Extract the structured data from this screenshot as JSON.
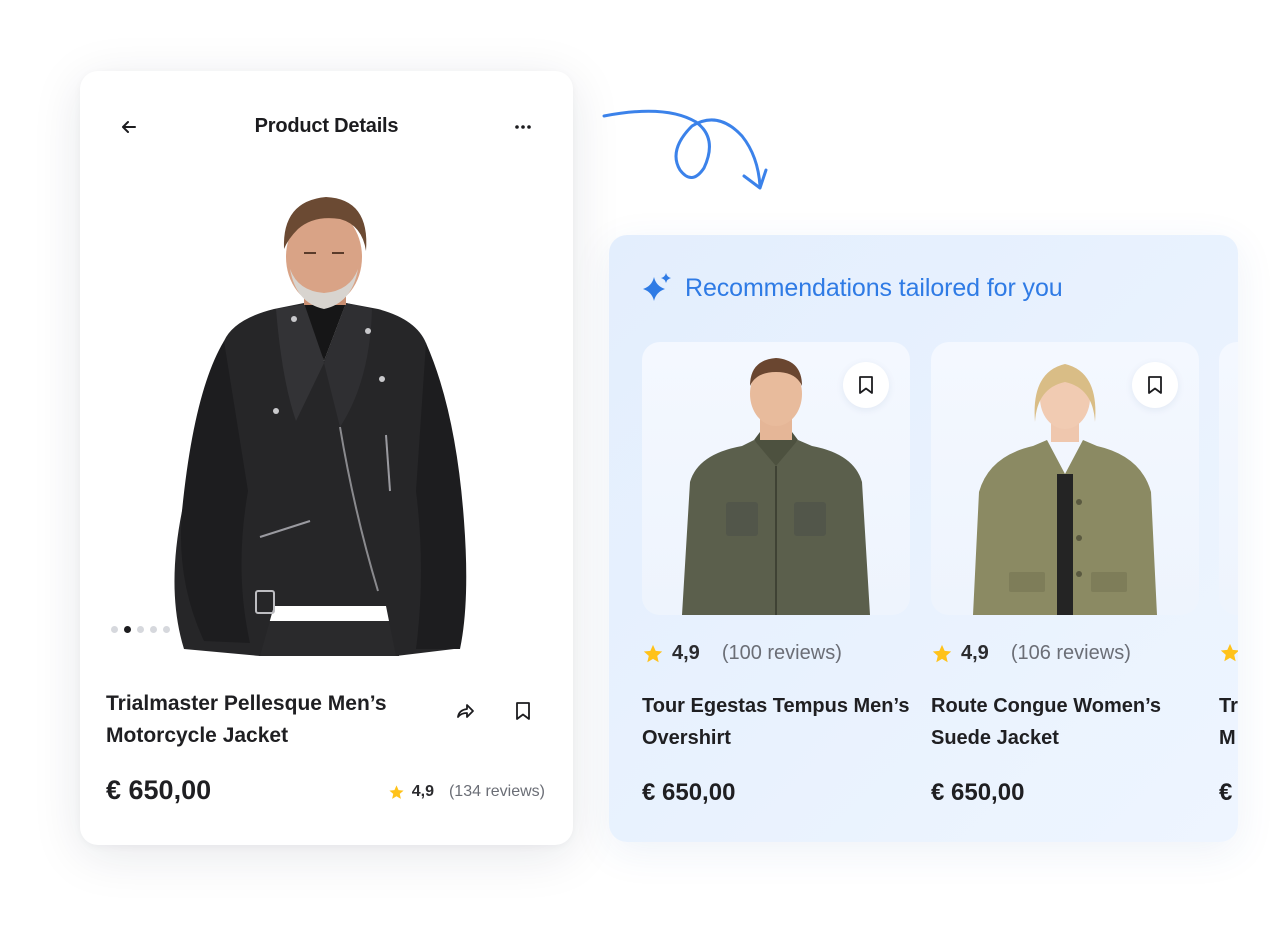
{
  "product": {
    "header_title": "Product Details",
    "name": "Trialmaster Pellesque Men’s Motorcycle Jacket",
    "price": "€ 650,00",
    "rating": "4,9",
    "reviews": "(134 reviews)",
    "carousel": {
      "total": 5,
      "active_index": 1
    }
  },
  "recommendations": {
    "title": "Recommendations tailored for you",
    "items": [
      {
        "rating": "4,9",
        "reviews": "(100 reviews)",
        "name": "Tour Egestas Tempus Men’s Overshirt",
        "price": "€ 650,00"
      },
      {
        "rating": "4,9",
        "reviews": "(106 reviews)",
        "name": "Route Congue Women’s Suede Jacket",
        "price": "€ 650,00"
      },
      {
        "rating": "",
        "reviews": "",
        "name": "Tr M",
        "price": "€"
      }
    ]
  },
  "icons": {
    "back": "arrow-left-icon",
    "more": "more-horizontal-icon",
    "share": "share-icon",
    "bookmark": "bookmark-icon",
    "star": "star-icon",
    "sparkle": "sparkle-icon"
  },
  "colors": {
    "accent": "#2F7BE5",
    "star": "#FFC21A",
    "text": "#1F1F22",
    "muted": "#6B6E76",
    "panel_bg": "#E7F0FD"
  }
}
